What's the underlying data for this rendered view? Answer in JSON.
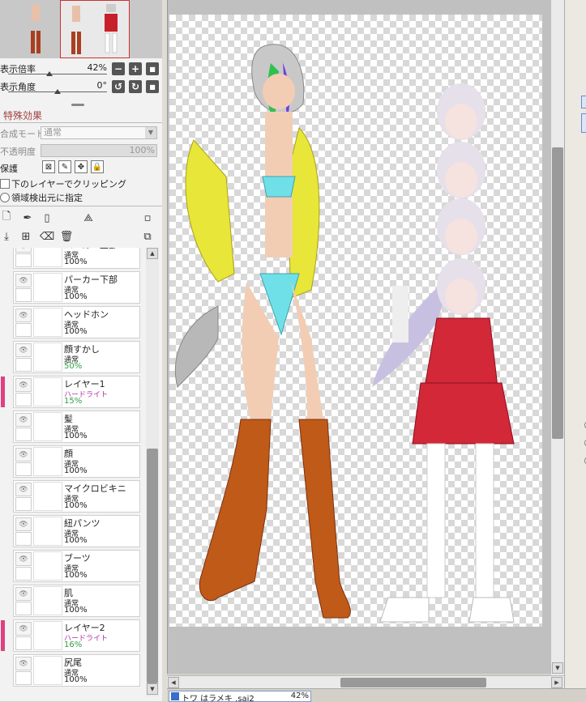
{
  "navigator": {
    "zoom_label": "表示倍率",
    "zoom_value": "42%",
    "zoom_fraction": 0.42,
    "angle_label": "表示角度",
    "angle_value": "0°",
    "angle_fraction": 0.5
  },
  "effects": {
    "title": "特殊効果",
    "blend_label": "合成モード",
    "blend_value": "通常",
    "opacity_label": "不透明度",
    "opacity_value": "100%",
    "protect_label": "保護",
    "clip_label": "下のレイヤーでクリッピング",
    "source_label": "領域検出元に指定"
  },
  "layers": [
    {
      "name": "パーカー上部",
      "mode": "通常",
      "opacity": "100%",
      "marked": false
    },
    {
      "name": "パーカー下部",
      "mode": "通常",
      "opacity": "100%",
      "marked": false
    },
    {
      "name": "ヘッドホン",
      "mode": "通常",
      "opacity": "100%",
      "marked": false
    },
    {
      "name": "顔すかし",
      "mode": "通常",
      "opacity": "50%",
      "marked": false
    },
    {
      "name": "レイヤー1",
      "mode": "ハードライト",
      "opacity": "15%",
      "marked": true
    },
    {
      "name": "髪",
      "mode": "通常",
      "opacity": "100%",
      "marked": false
    },
    {
      "name": "顔",
      "mode": "通常",
      "opacity": "100%",
      "marked": false
    },
    {
      "name": "マイクロビキニ",
      "mode": "通常",
      "opacity": "100%",
      "marked": false
    },
    {
      "name": "紐パンツ",
      "mode": "通常",
      "opacity": "100%",
      "marked": false
    },
    {
      "name": "ブーツ",
      "mode": "通常",
      "opacity": "100%",
      "marked": false
    },
    {
      "name": "肌",
      "mode": "通常",
      "opacity": "100%",
      "marked": false
    },
    {
      "name": "レイヤー2",
      "mode": "ハードライト",
      "opacity": "16%",
      "marked": true
    },
    {
      "name": "尻尾",
      "mode": "通常",
      "opacity": "100%",
      "marked": false
    }
  ],
  "status": {
    "doc_name": "トワ はラメキ .sai2",
    "zoom": "42%"
  },
  "colors": {
    "layer_mark": "#e04080",
    "hardlight_text": "#b030a0",
    "reduced_opacity_text": "#30a040"
  }
}
